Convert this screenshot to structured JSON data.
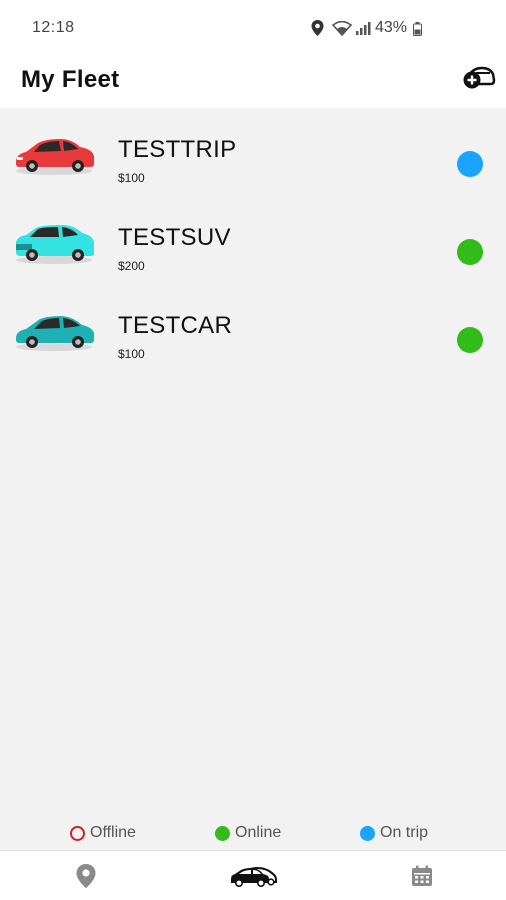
{
  "status_bar": {
    "time": "12:18",
    "battery": "43%",
    "icons": [
      "location-icon",
      "wifi-icon",
      "signal-icon",
      "battery-icon"
    ]
  },
  "header": {
    "title": "My Fleet",
    "add_icon": "add-car-icon"
  },
  "fleet": [
    {
      "name": "TESTTRIP",
      "price": "$100",
      "car_color": "#e83a3a",
      "status": "on-trip",
      "status_color": "#1aa3ff"
    },
    {
      "name": "TESTSUV",
      "price": "$200",
      "car_color": "#35e2e2",
      "status": "online",
      "status_color": "#33bb1a"
    },
    {
      "name": "TESTCAR",
      "price": "$100",
      "car_color": "#1fb0b4",
      "status": "online",
      "status_color": "#33bb1a"
    }
  ],
  "legend": {
    "offline": {
      "label": "Offline",
      "color": "#cc2222"
    },
    "online": {
      "label": "Online",
      "color": "#33bb1a"
    },
    "on_trip": {
      "label": "On trip",
      "color": "#1aa3ff"
    }
  },
  "bottom_nav": {
    "items": [
      {
        "icon": "map-pin-icon",
        "active": false
      },
      {
        "icon": "fleet-cars-icon",
        "active": true
      },
      {
        "icon": "calendar-icon",
        "active": false
      }
    ]
  }
}
